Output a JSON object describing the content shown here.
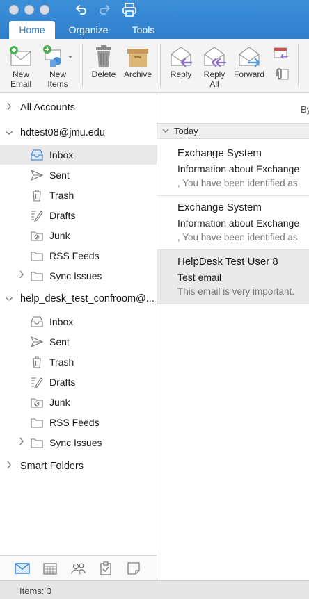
{
  "tabs": [
    "Home",
    "Organize",
    "Tools"
  ],
  "ribbon": {
    "new_email": "New\nEmail",
    "new_items": "New\nItems",
    "delete": "Delete",
    "archive": "Archive",
    "reply": "Reply",
    "reply_all": "Reply\nAll",
    "forward": "Forward"
  },
  "folder_pane": {
    "all_accounts": "All Accounts",
    "accounts": [
      {
        "name": "hdtest08@jmu.edu",
        "folders": [
          "Inbox",
          "Sent",
          "Trash",
          "Drafts",
          "Junk",
          "RSS Feeds",
          "Sync Issues"
        ]
      },
      {
        "name": "help_desk_test_confroom@...",
        "folders": [
          "Inbox",
          "Sent",
          "Trash",
          "Drafts",
          "Junk",
          "RSS Feeds",
          "Sync Issues"
        ]
      }
    ],
    "smart_folders": "Smart Folders"
  },
  "message_list": {
    "sort_label": "By",
    "group": "Today",
    "messages": [
      {
        "from": "Exchange System",
        "subject": "Information about Exchange",
        "preview": ", You have been identified as"
      },
      {
        "from": "Exchange System",
        "subject": "Information about Exchange",
        "preview": ", You have been identified as"
      },
      {
        "from": "HelpDesk Test User 8",
        "subject": "Test email",
        "preview": "This email is very important."
      }
    ]
  },
  "status": {
    "items": "Items: 3"
  },
  "colors": {
    "accent": "#2f7fcc",
    "selection": "#e9e9e9"
  }
}
